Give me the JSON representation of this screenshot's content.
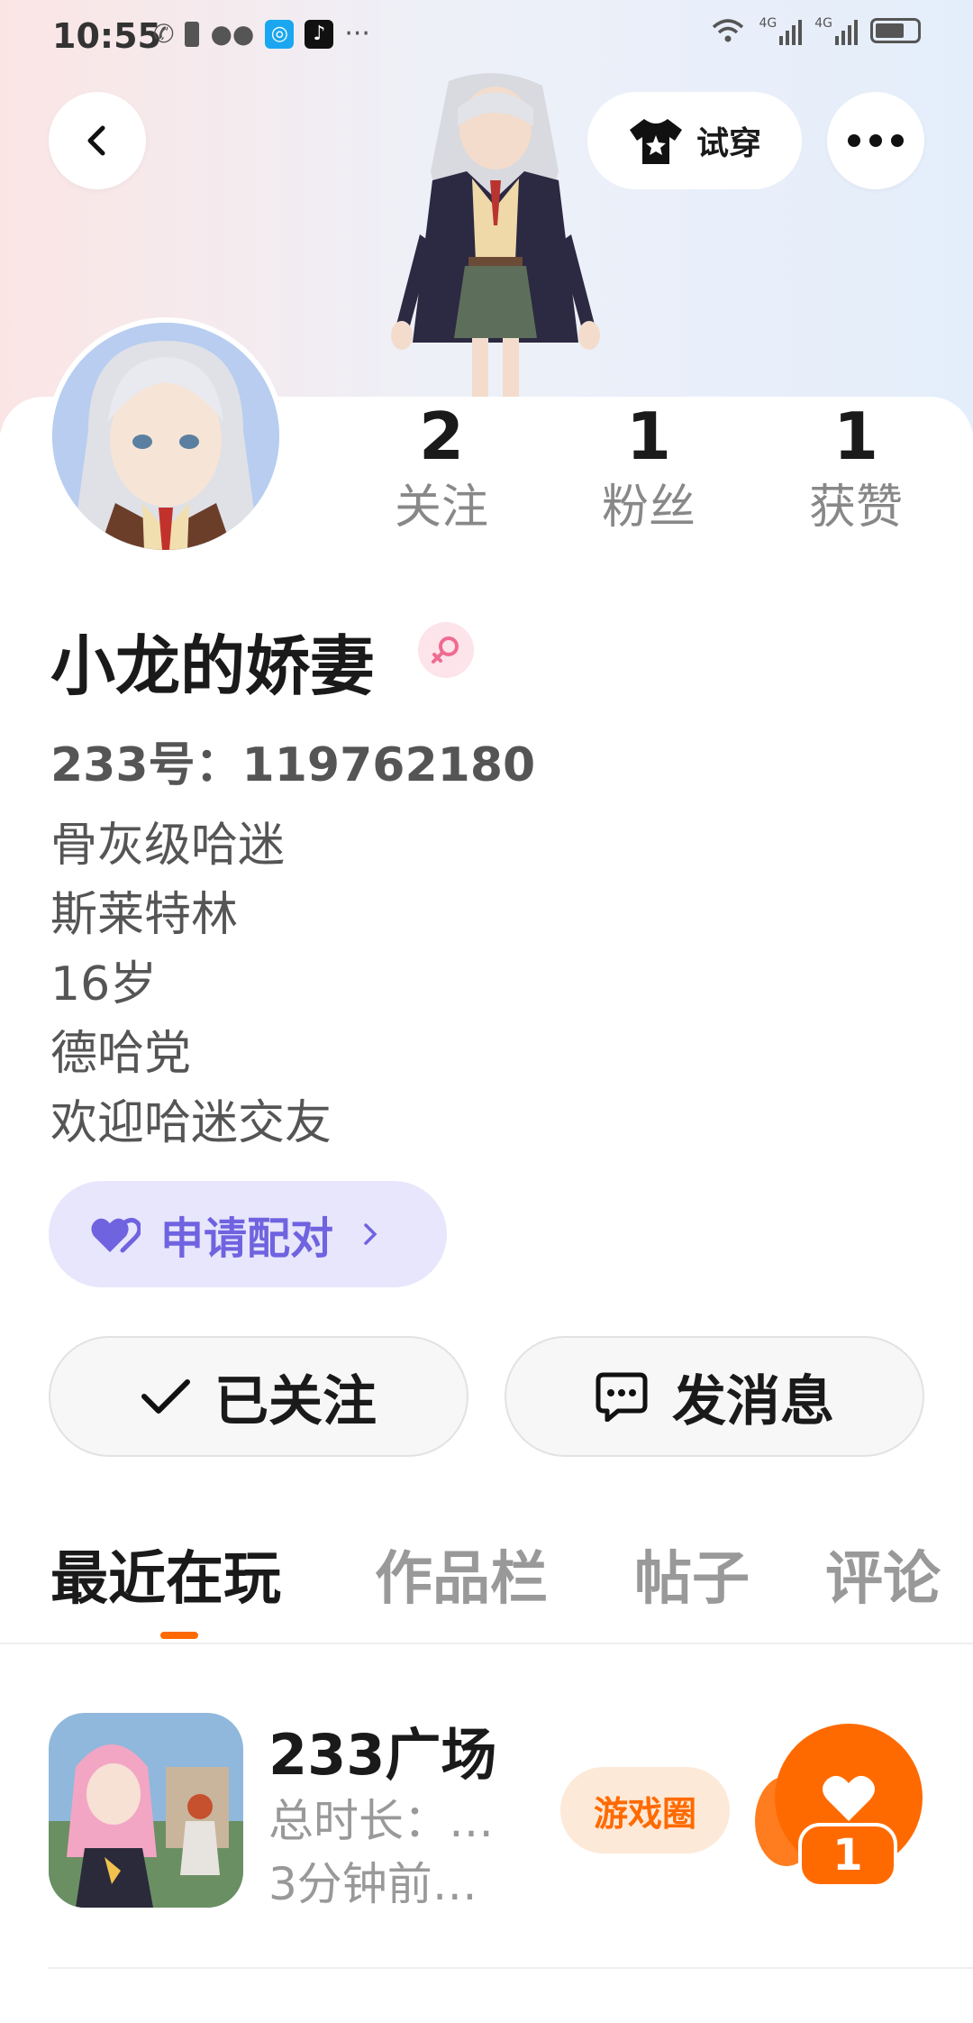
{
  "status_bar": {
    "time": "10:55",
    "more": "···",
    "network_1": "4G",
    "network_2": "4G"
  },
  "header": {
    "tryon_label": "试穿"
  },
  "stats": [
    {
      "value": "2",
      "label": "关注"
    },
    {
      "value": "1",
      "label": "粉丝"
    },
    {
      "value": "1",
      "label": "获赞"
    }
  ],
  "profile": {
    "username": "小龙的娇妻",
    "user_id": "233号：119762180",
    "bio": [
      "骨灰级哈迷",
      "斯莱特林",
      "16岁",
      "德哈党",
      "欢迎哈迷交友"
    ]
  },
  "pair_button": {
    "label": "申请配对"
  },
  "actions": {
    "follow_label": "已关注",
    "message_label": "发消息"
  },
  "tabs": [
    "最近在玩",
    "作品栏",
    "帖子",
    "评论"
  ],
  "recent_game": {
    "title": "233广场",
    "total_time": "总时长：…",
    "last_played": "3分钟前…",
    "circle_label": "游戏圈",
    "like_count": "1"
  },
  "colors": {
    "accent": "#ff6a00",
    "pair_purple": "#6f63e0",
    "pair_bg": "#e8e6fc"
  }
}
